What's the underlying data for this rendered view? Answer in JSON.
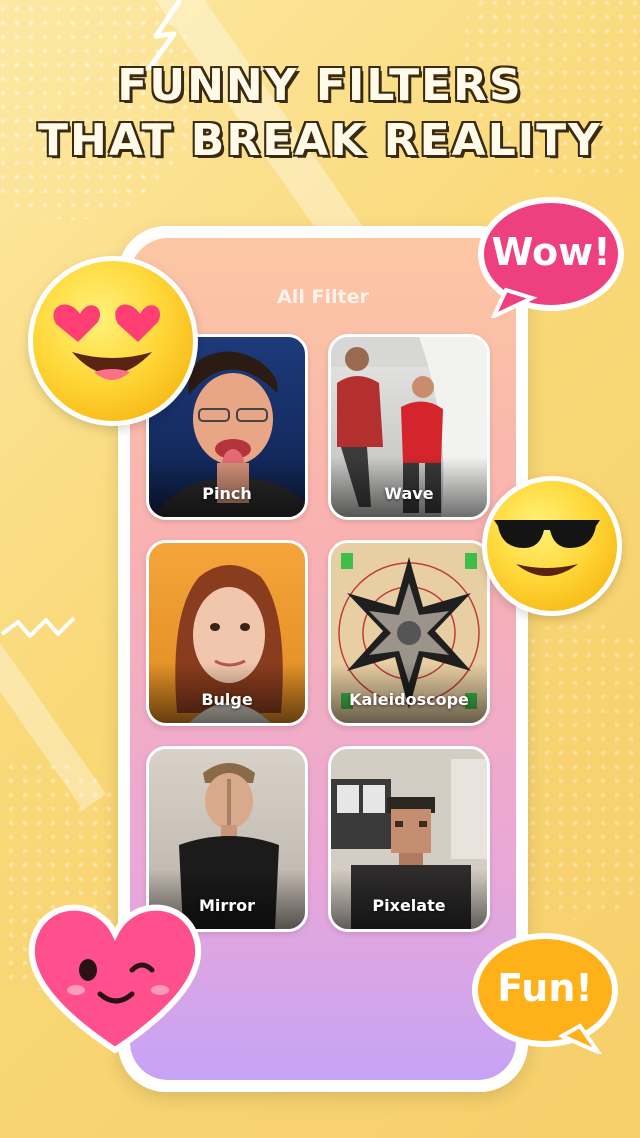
{
  "headline": {
    "line1": "FUNNY FILTERS",
    "line2": "THAT BREAK REALITY"
  },
  "screen": {
    "title": "All Filter",
    "filters": [
      {
        "label": "Pinch"
      },
      {
        "label": "Wave"
      },
      {
        "label": "Bulge"
      },
      {
        "label": "Kaleidoscope"
      },
      {
        "label": "Mirror"
      },
      {
        "label": "Pixelate"
      }
    ]
  },
  "stickers": {
    "wow": "Wow!",
    "fun": "Fun!",
    "icons": [
      "heart-eyes-emoji-icon",
      "sunglasses-emoji-icon",
      "winking-heart-icon"
    ]
  },
  "colors": {
    "background": "#f9d877",
    "wow_bubble": "#ee3f7f",
    "fun_bubble": "#ffb11a",
    "headline_text": "#fffbe8"
  }
}
